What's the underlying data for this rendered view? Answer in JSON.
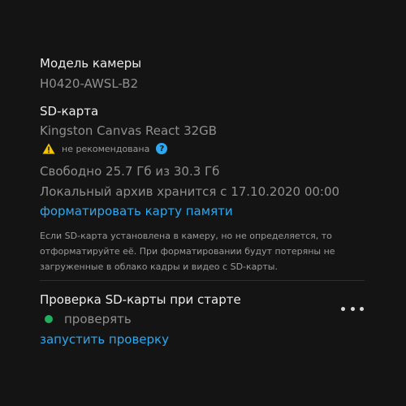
{
  "camera": {
    "model_label": "Модель камеры",
    "model_value": "H0420-AWSL-B2"
  },
  "sd_card": {
    "label": "SD-карта",
    "name": "Kingston Canvas React 32GB",
    "warning_text": "не рекомендована",
    "free_space": "Свободно 25.7 Гб из 30.3 Гб",
    "archive_text": "Локальный архив хранится с 17.10.2020 00:00",
    "format_link": "форматировать карту памяти",
    "note_line1": "Если SD-карта установлена в камеру, но не определяется, то",
    "note_line2": "отформатируйте её. При форматировании будут потеряны не",
    "note_line3": "загруженные в облако кадры и видео с SD-карты."
  },
  "startup_check": {
    "label": "Проверка SD-карты при старте",
    "status": "проверять",
    "run_link": "запустить проверку"
  },
  "colors": {
    "background": "#141414",
    "accent": "#2ea8f0",
    "status_green": "#20b060",
    "warning_yellow": "#f5c400"
  },
  "icons": {
    "warning": "warning-triangle-icon",
    "help": "question-circle-icon",
    "more": "more-horizontal-icon"
  }
}
